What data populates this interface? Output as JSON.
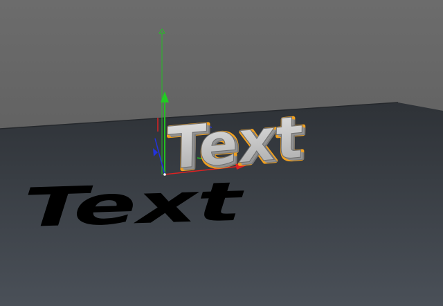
{
  "viewport": {
    "object_text": "Text",
    "shadow_text": "Text"
  },
  "colors": {
    "background_top": "#6a6a6a",
    "background_bottom": "#4d4d4d",
    "floor_near": "#3a3f44",
    "floor_far": "#2f3338",
    "text_face": "#c9c9c9",
    "text_edge": "#8f8f8f",
    "selection_outline": "#f0a020",
    "shadow": "#000000",
    "axis_y": "#22c022",
    "axis_x": "#dd2222",
    "axis_z": "#2233dd"
  },
  "icons": {
    "gizmo": "move-gizmo-icon",
    "y_arrow": "y-axis-arrow-icon",
    "x_arrow": "x-axis-arrow-icon",
    "z_arrow": "z-axis-arrow-icon"
  }
}
